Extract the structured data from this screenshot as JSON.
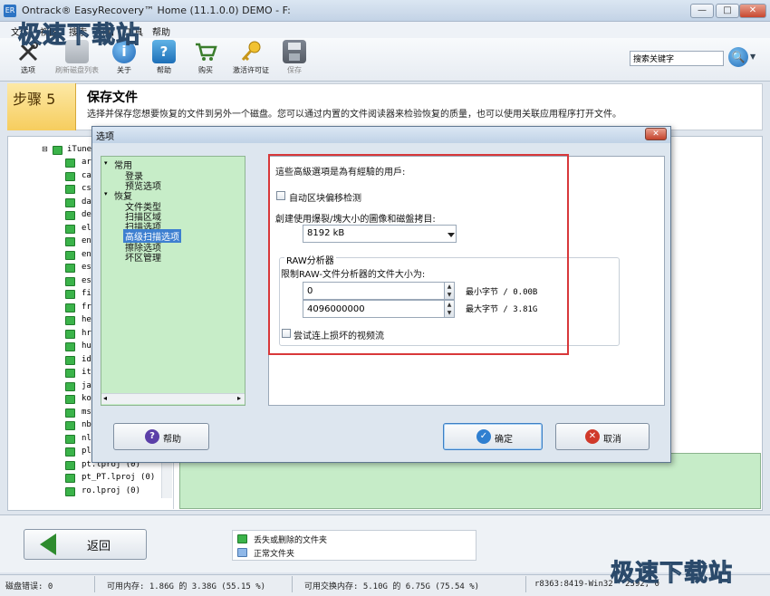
{
  "window": {
    "title": "Ontrack® EasyRecovery™ Home (11.1.0.0) DEMO - F:",
    "app_icon": "ER",
    "minimize": "—",
    "maximize": "□",
    "close": "✕"
  },
  "menu": [
    "文件",
    "视图",
    "搜索",
    "附加",
    "工具",
    "帮助"
  ],
  "toolbar": {
    "items": [
      {
        "label": "选项",
        "icon": "tools-icon"
      },
      {
        "label": "刷新磁盘列表",
        "icon": "disk-icon"
      },
      {
        "label": "关于",
        "icon": "info-icon"
      },
      {
        "label": "帮助",
        "icon": "help-icon"
      },
      {
        "label": "购买",
        "icon": "cart-icon"
      },
      {
        "label": "激活许可证",
        "icon": "key-icon"
      },
      {
        "label": "保存",
        "icon": "save-icon"
      }
    ],
    "search_value": "搜索关键字",
    "search_icon": "🔍",
    "search_dropdown": "▼"
  },
  "step": {
    "label": "步骤 5",
    "title": "保存文件",
    "description": "选择并保存您想要恢复的文件到另外一个磁盘。您可以通过内置的文件阅读器来检验恢复的质量，也可以使用关联应用程序打开文件。"
  },
  "file_tree": {
    "root": "iTunes",
    "items": [
      "ar",
      "ca",
      "cs",
      "da",
      "de",
      "el",
      "en",
      "en",
      "es",
      "es",
      "fi",
      "fr",
      "he",
      "hr",
      "hu",
      "id",
      "it",
      "ja",
      "ko",
      "ms",
      "nb",
      "nl",
      "pl",
      "pt.lproj (0)",
      "pt_PT.lproj (0)",
      "ro.lproj (0)"
    ]
  },
  "dialog": {
    "title": "选项",
    "close": "✕",
    "nav": {
      "group1": "常用",
      "group1_items": [
        "登录",
        "预览选项"
      ],
      "group2": "恢复",
      "group2_items": [
        "文件类型",
        "扫描区域",
        "扫描选项",
        "高级扫描选项",
        "擦除选项",
        "坏区管理"
      ],
      "selected": "高级扫描选项",
      "scroll_left": "◂",
      "scroll_right": "▸"
    },
    "settings": {
      "notice": "這些高級選項是為有經驗的用戶:",
      "auto_offset_label": "自动区块偏移检测",
      "cache_label": "創建使用爆裂/塊大小的圖像和磁盤拷目:",
      "cache_value": "8192 kB",
      "raw_group_title": "RAW分析器",
      "raw_limit_label": "限制RAW-文件分析器的文件大小为:",
      "min_value": "0",
      "min_bytes": "最小字节 / 0.00B",
      "max_value": "4096000000",
      "max_bytes": "最大字节 / 3.81G",
      "video_label": "尝试连上损坏的视频流",
      "spin_up": "▲",
      "spin_down": "▼"
    },
    "buttons": {
      "help": "帮助",
      "ok": "确定",
      "cancel": "取消",
      "help_icon": "?",
      "ok_icon": "✓",
      "cancel_icon": "✕"
    }
  },
  "bottom": {
    "back_label": "返回",
    "legend": [
      "丢失或删除的文件夹",
      "正常文件夹"
    ]
  },
  "status": {
    "disk_errors": "磁盘错误: 0",
    "memory": "可用内存: 1.86G 的 3.38G (55.15 %)",
    "swap": "可用交换内存: 5.10G 的 6.75G (75.54 %)",
    "build": "r8363:8419-Win32",
    "extra": "2592, 0"
  },
  "watermark": {
    "top": "极速下载站",
    "bottom": "极速下载站"
  }
}
